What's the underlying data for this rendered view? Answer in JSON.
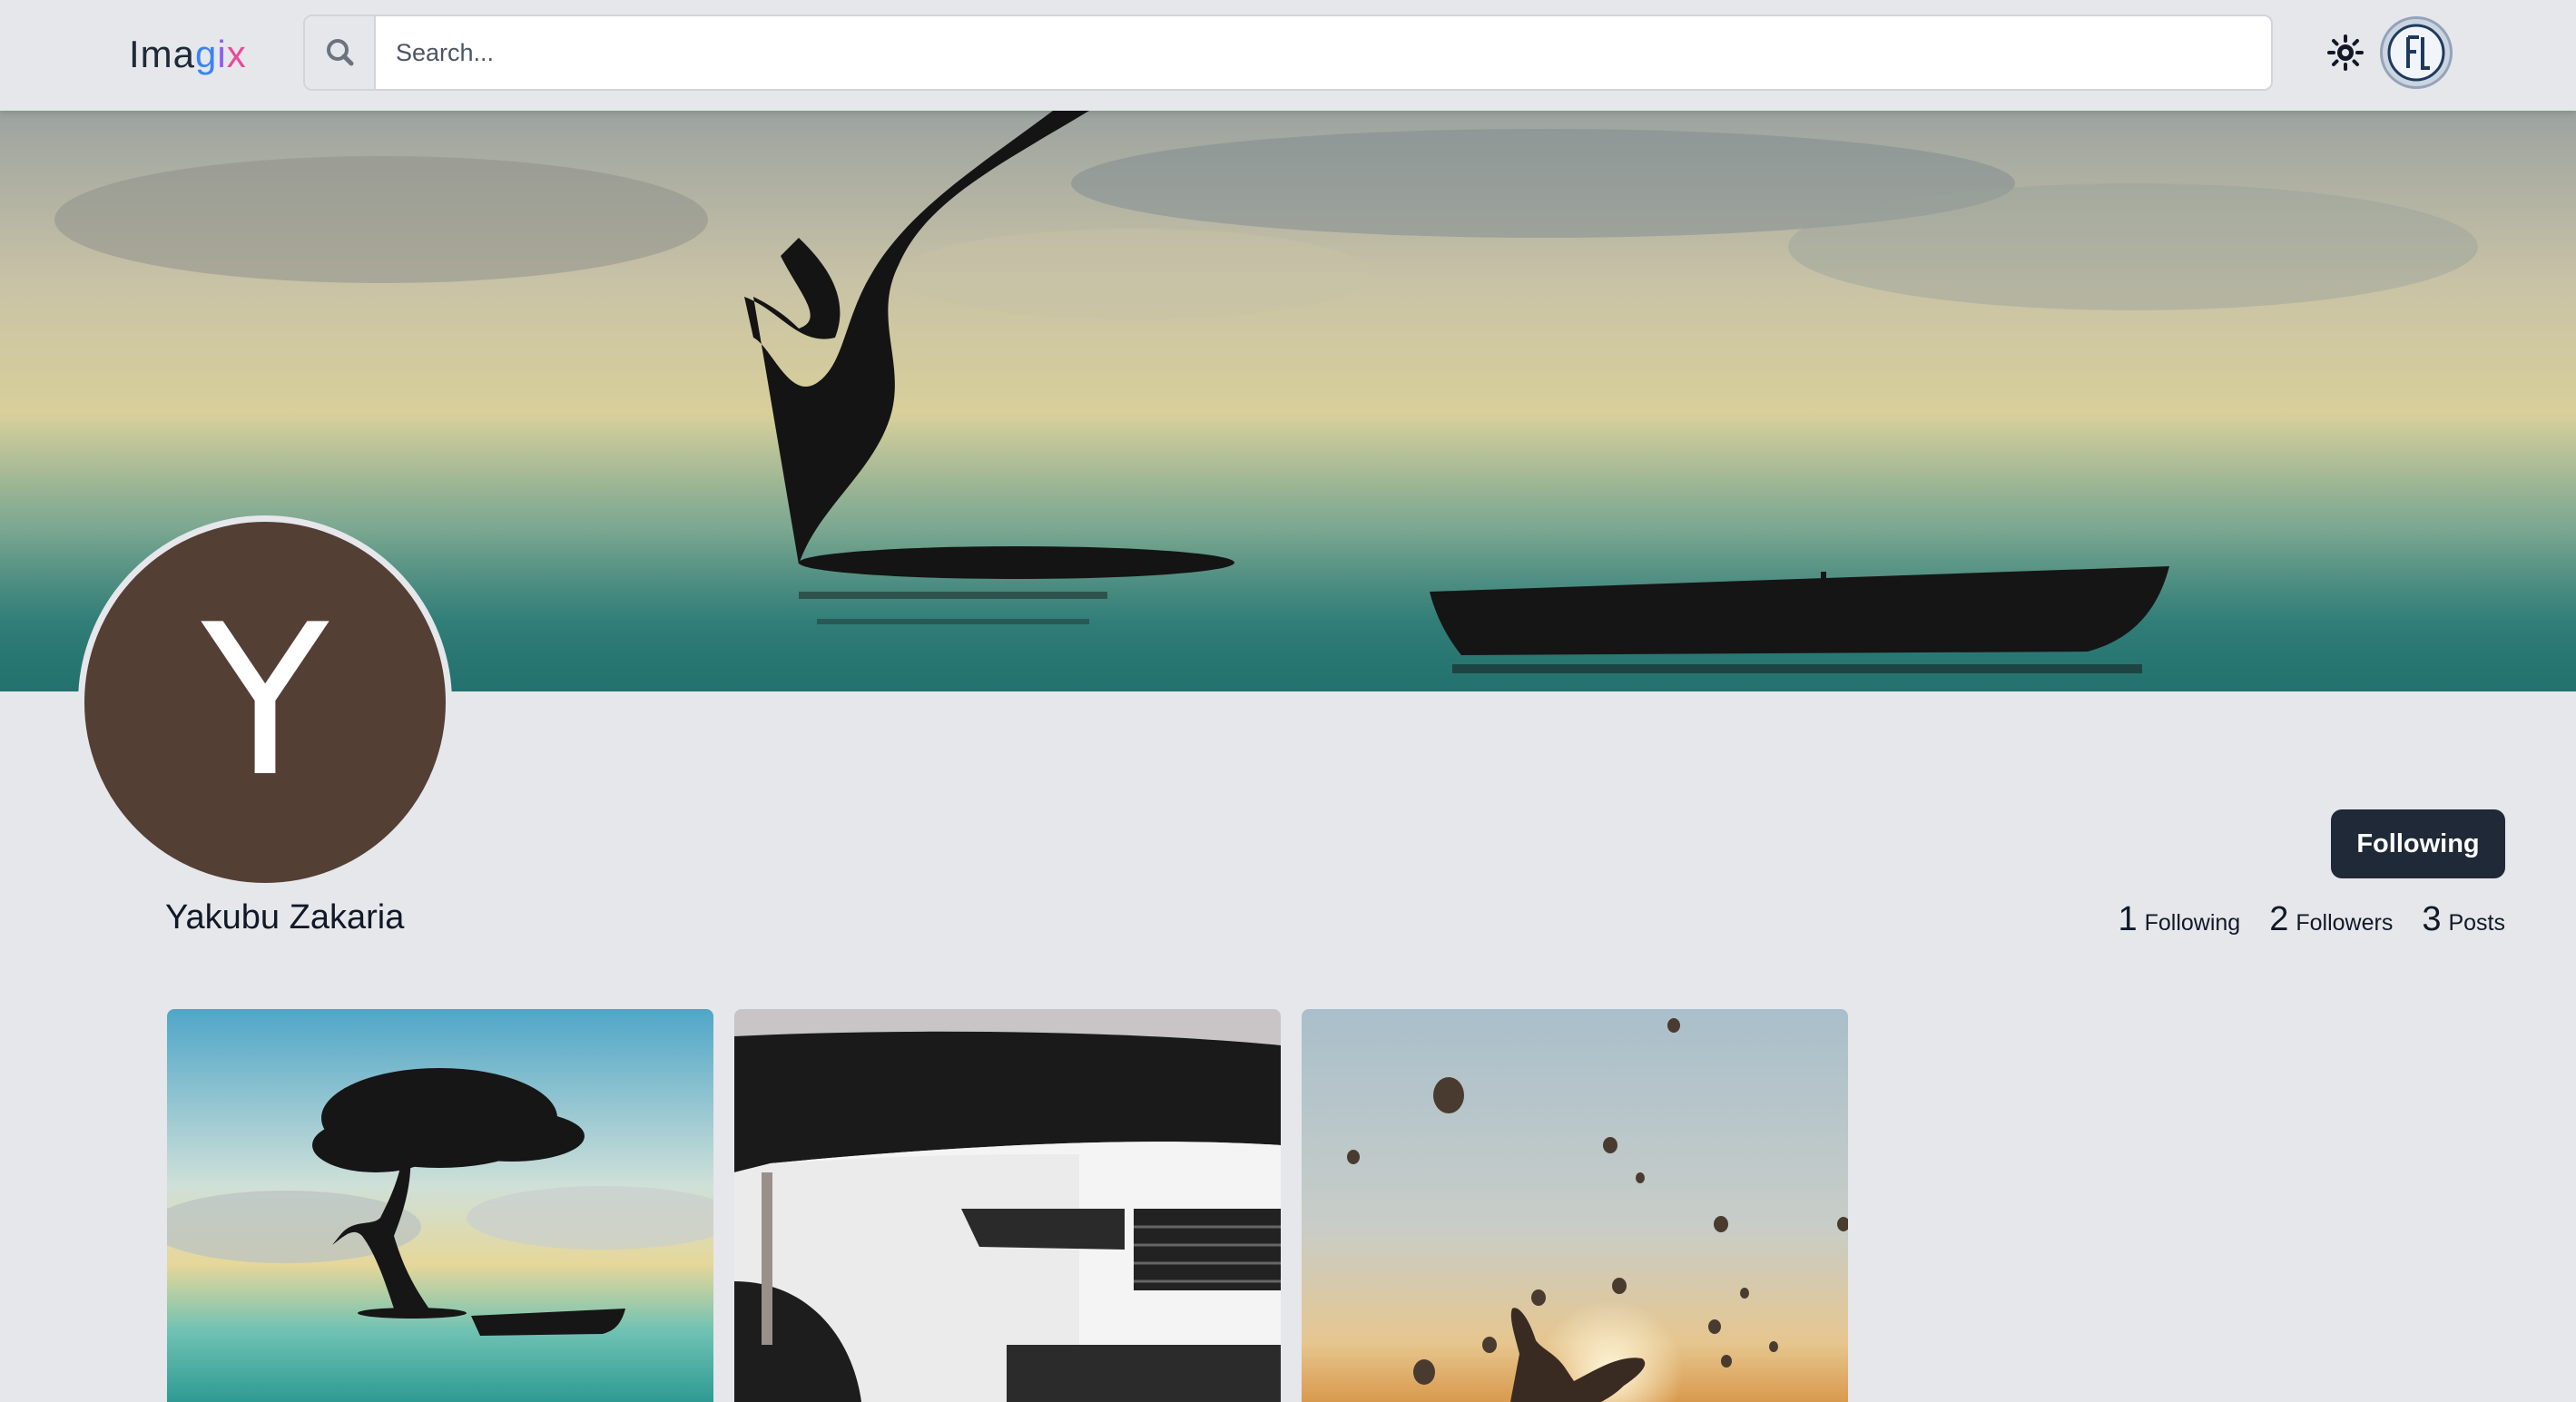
{
  "header": {
    "logo_part1": "Ima",
    "logo_g": "g",
    "logo_i": "i",
    "logo_x": "x",
    "search_placeholder": "Search...",
    "icons": {
      "search": "search-icon",
      "theme": "sun-icon",
      "user": "user-avatar"
    }
  },
  "profile": {
    "initial": "Y",
    "name": "Yakubu Zakaria",
    "avatar_color": "#543f35",
    "follow_button_label": "Following",
    "stats": [
      {
        "value": "1",
        "label": "Following"
      },
      {
        "value": "2",
        "label": "Followers"
      },
      {
        "value": "3",
        "label": "Posts"
      }
    ]
  },
  "posts": [
    {
      "subject": "tree-in-water-with-boat"
    },
    {
      "subject": "white-range-rover"
    },
    {
      "subject": "hot-air-balloons-hand-sunset"
    }
  ],
  "colors": {
    "background": "#e5e7eb",
    "button": "#1f2937",
    "logo_g": "#3b82f6",
    "logo_i": "#8b5cf6",
    "logo_x": "#ec4899"
  }
}
